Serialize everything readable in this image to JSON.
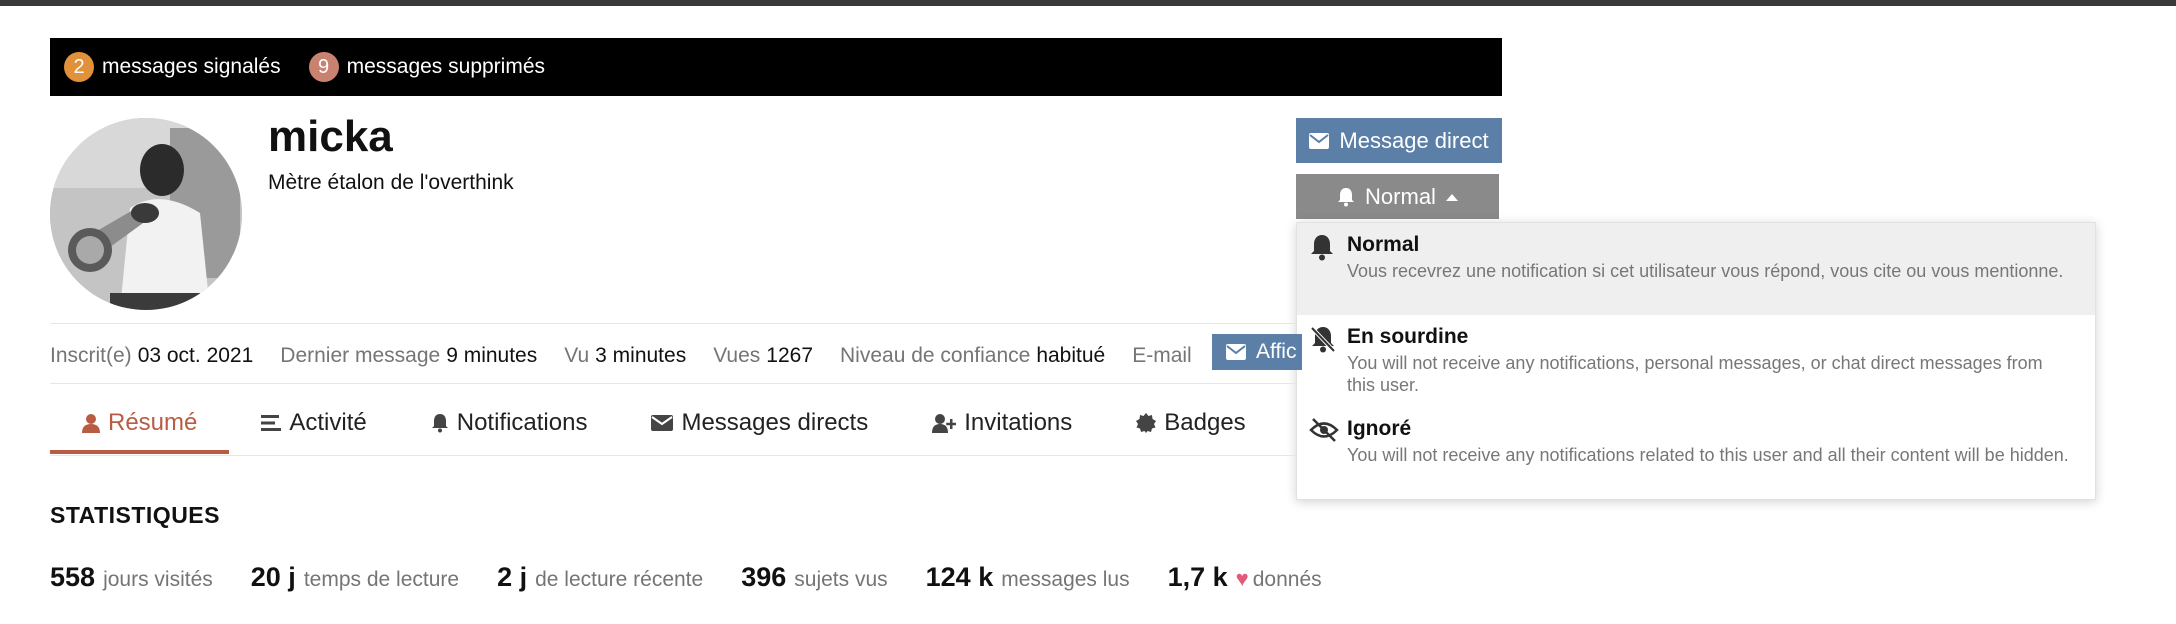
{
  "alerts": [
    {
      "count": "2",
      "label": "messages signalés",
      "color": "#e0913a"
    },
    {
      "count": "9",
      "label": "messages supprimés",
      "color": "#c9826f"
    }
  ],
  "user": {
    "username": "micka",
    "title": "Mètre étalon de l'overthink"
  },
  "actions": {
    "direct_message": "Message direct",
    "notification_level": "Normal"
  },
  "notification_menu": {
    "items": [
      {
        "title": "Normal",
        "icon": "bell-icon",
        "description": "Vous recevrez une notification si cet utilisateur vous répond, vous cite ou vous mentionne."
      },
      {
        "title": "En sourdine",
        "icon": "bell-slash-icon",
        "description": "You will not receive any notifications, personal messages, or chat direct messages from this user."
      },
      {
        "title": "Ignoré",
        "icon": "eye-slash-icon",
        "description": "You will not receive any notifications related to this user and all their content will be hidden."
      }
    ]
  },
  "meta": {
    "joined_label": "Inscrit(e)",
    "joined_value": "03 oct. 2021",
    "last_post_label": "Dernier message",
    "last_post_value": "9 minutes",
    "seen_label": "Vu",
    "seen_value": "3 minutes",
    "views_label": "Vues",
    "views_value": "1267",
    "trust_label": "Niveau de confiance",
    "trust_value": "habitué",
    "email_label": "E-mail",
    "email_button": "Affic"
  },
  "tabs": [
    {
      "label": "Résumé",
      "icon": "user-icon"
    },
    {
      "label": "Activité",
      "icon": "list-icon"
    },
    {
      "label": "Notifications",
      "icon": "bell-icon"
    },
    {
      "label": "Messages directs",
      "icon": "envelope-icon"
    },
    {
      "label": "Invitations",
      "icon": "user-plus-icon"
    },
    {
      "label": "Badges",
      "icon": "certificate-icon"
    }
  ],
  "stats": {
    "title": "STATISTIQUES",
    "items": [
      {
        "value": "558",
        "label": "jours visités"
      },
      {
        "value": "20 j",
        "label": "temps de lecture"
      },
      {
        "value": "2 j",
        "label": "de lecture récente"
      },
      {
        "value": "396",
        "label": "sujets vus"
      },
      {
        "value": "124 k",
        "label": "messages lus"
      },
      {
        "value": "1,7 k",
        "label": "donnés",
        "heart": "♥"
      }
    ]
  },
  "colors": {
    "accent": "#b85c44",
    "button_blue": "#5b7fa6",
    "button_gray": "#8a8a8a",
    "heart": "#e35b7b"
  }
}
